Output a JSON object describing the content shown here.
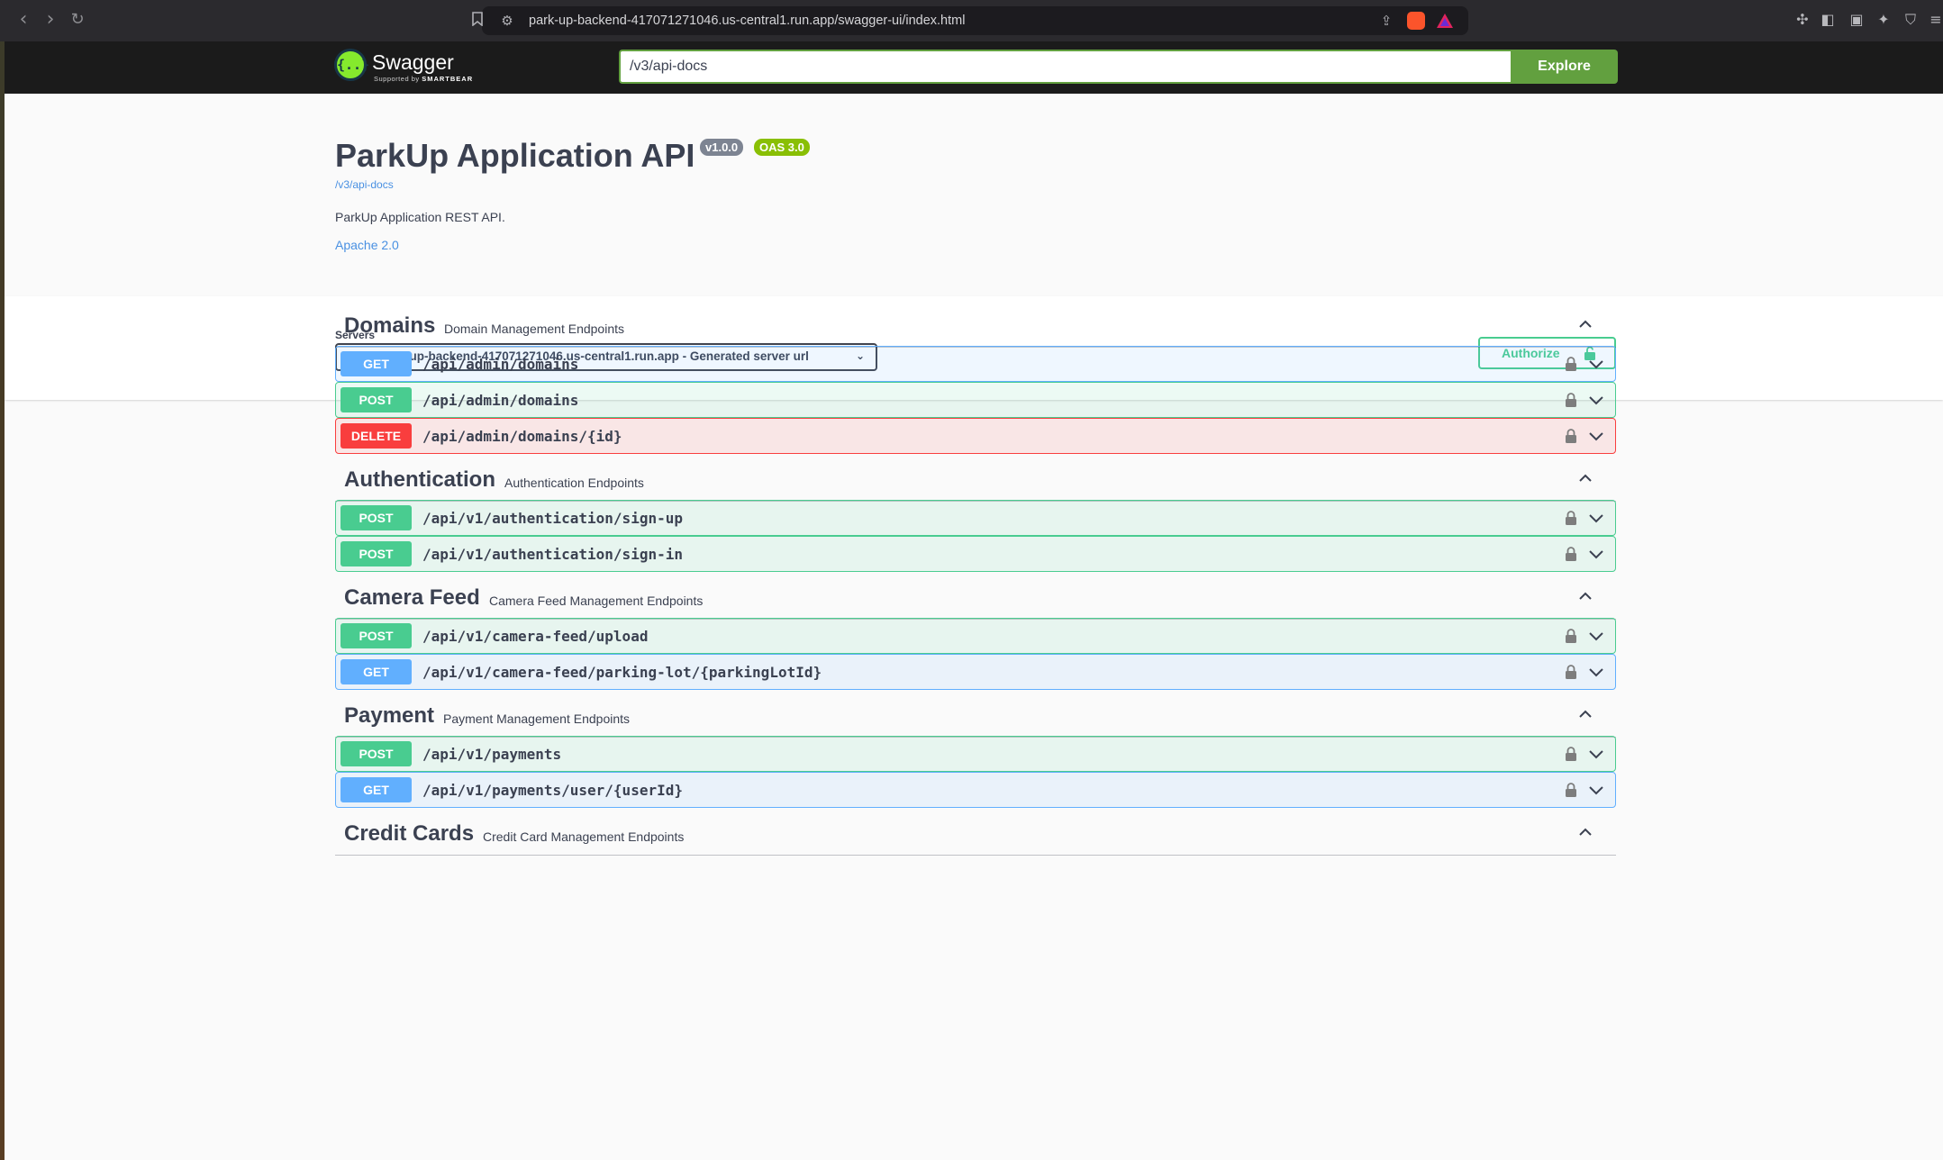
{
  "browser": {
    "url": "park-up-backend-417071271046.us-central1.run.app/swagger-ui/index.html"
  },
  "topbar": {
    "logo_title": "Swagger",
    "logo_sub_prefix": "Supported by",
    "logo_sub_brand": "SMARTBEAR",
    "spec_url": "/v3/api-docs",
    "explore_label": "Explore"
  },
  "info": {
    "title": "ParkUp Application API",
    "version_badge": "v1.0.0",
    "oas_badge": "OAS 3.0",
    "spec_link": "/v3/api-docs",
    "description": "ParkUp Application REST API.",
    "license": "Apache 2.0"
  },
  "servers": {
    "label": "Servers",
    "selected": "http://park-up-backend-417071271046.us-central1.run.app - Generated server url",
    "authorize_label": "Authorize"
  },
  "tags": [
    {
      "name": "Domains",
      "description": "Domain Management Endpoints",
      "operations": [
        {
          "method": "GET",
          "path": "/api/admin/domains"
        },
        {
          "method": "POST",
          "path": "/api/admin/domains"
        },
        {
          "method": "DELETE",
          "path": "/api/admin/domains/{id}"
        }
      ]
    },
    {
      "name": "Authentication",
      "description": "Authentication Endpoints",
      "operations": [
        {
          "method": "POST",
          "path": "/api/v1/authentication/sign-up"
        },
        {
          "method": "POST",
          "path": "/api/v1/authentication/sign-in"
        }
      ]
    },
    {
      "name": "Camera Feed",
      "description": "Camera Feed Management Endpoints",
      "operations": [
        {
          "method": "POST",
          "path": "/api/v1/camera-feed/upload"
        },
        {
          "method": "GET",
          "path": "/api/v1/camera-feed/parking-lot/{parkingLotId}"
        }
      ]
    },
    {
      "name": "Payment",
      "description": "Payment Management Endpoints",
      "operations": [
        {
          "method": "POST",
          "path": "/api/v1/payments"
        },
        {
          "method": "GET",
          "path": "/api/v1/payments/user/{userId}"
        }
      ]
    },
    {
      "name": "Credit Cards",
      "description": "Credit Card Management Endpoints",
      "operations": []
    }
  ],
  "colors": {
    "get": "#61affe",
    "post": "#49cc90",
    "delete": "#f93e3e",
    "swagger_green": "#62a03f"
  }
}
